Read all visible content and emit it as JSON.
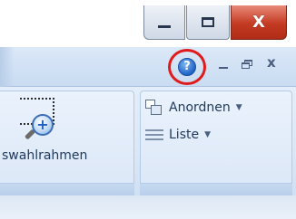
{
  "window": {
    "minimize_icon": "minimize-icon",
    "maximize_icon": "maximize-icon",
    "close_glyph": "X"
  },
  "ribbon_tabs": {
    "help_glyph": "?",
    "help_highlight_color": "#e01b1b",
    "mdi_close_glyph": "x"
  },
  "groups": {
    "left": {
      "label": "swahlrahmen"
    },
    "right": {
      "items": [
        {
          "label": "Anordnen",
          "icon": "arrange-windows-icon",
          "dropdown": "▼"
        },
        {
          "label": "Liste",
          "icon": "list-icon",
          "dropdown": "▼"
        }
      ]
    }
  },
  "colors": {
    "close_button": "#c43a22",
    "ribbon_text": "#1e395b",
    "ribbon_band": "#c9dcf2"
  }
}
